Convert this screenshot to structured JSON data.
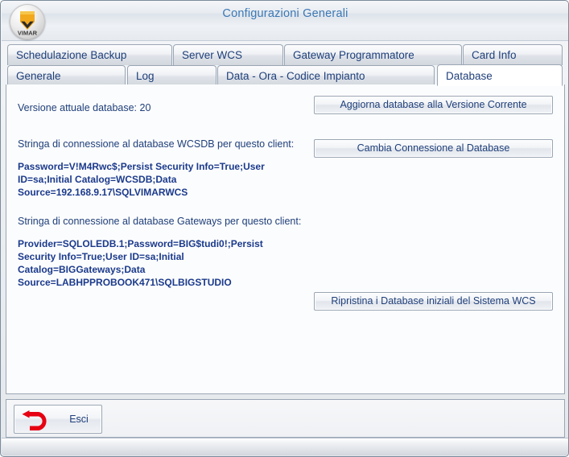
{
  "window": {
    "title": "Configurazioni Generali",
    "logo_text": "VIMAR",
    "accent_color": "#3b78b5",
    "text_color": "#1f3f7a"
  },
  "tabs": {
    "row1": [
      {
        "label": "Schedulazione Backup",
        "selected": false
      },
      {
        "label": "Server WCS",
        "selected": false
      },
      {
        "label": "Gateway Programmatore",
        "selected": false
      },
      {
        "label": "Card Info",
        "selected": false
      }
    ],
    "row2": [
      {
        "label": "Generale",
        "selected": false
      },
      {
        "label": "Log",
        "selected": false
      },
      {
        "label": "Data - Ora - Codice Impianto",
        "selected": false
      },
      {
        "label": "Database",
        "selected": true
      }
    ]
  },
  "main": {
    "version_label": "Versione attuale database:  20",
    "wcsdb_caption": "Stringa di connessione al database WCSDB per questo client:",
    "wcsdb_connection_string": "Password=V!M4Rwc$;Persist Security Info=True;User ID=sa;Initial Catalog=WCSDB;Data Source=192.168.9.17\\SQLVIMARWCS",
    "gateways_caption": "Stringa di connessione al database Gateways per questo client:",
    "gateways_connection_string": "Provider=SQLOLEDB.1;Password=BIG$tudi0!;Persist Security Info=True;User ID=sa;Initial Catalog=BIGGateways;Data Source=LABHPPROBOOK471\\SQLBIGSTUDIO",
    "buttons": {
      "update_db": "Aggiorna database alla Versione Corrente",
      "change_connection": "Cambia Connessione al Database",
      "restore_db": "Ripristina i Database iniziali del Sistema WCS"
    }
  },
  "footer": {
    "exit_label": "Esci",
    "exit_icon_color": "#e60012"
  }
}
